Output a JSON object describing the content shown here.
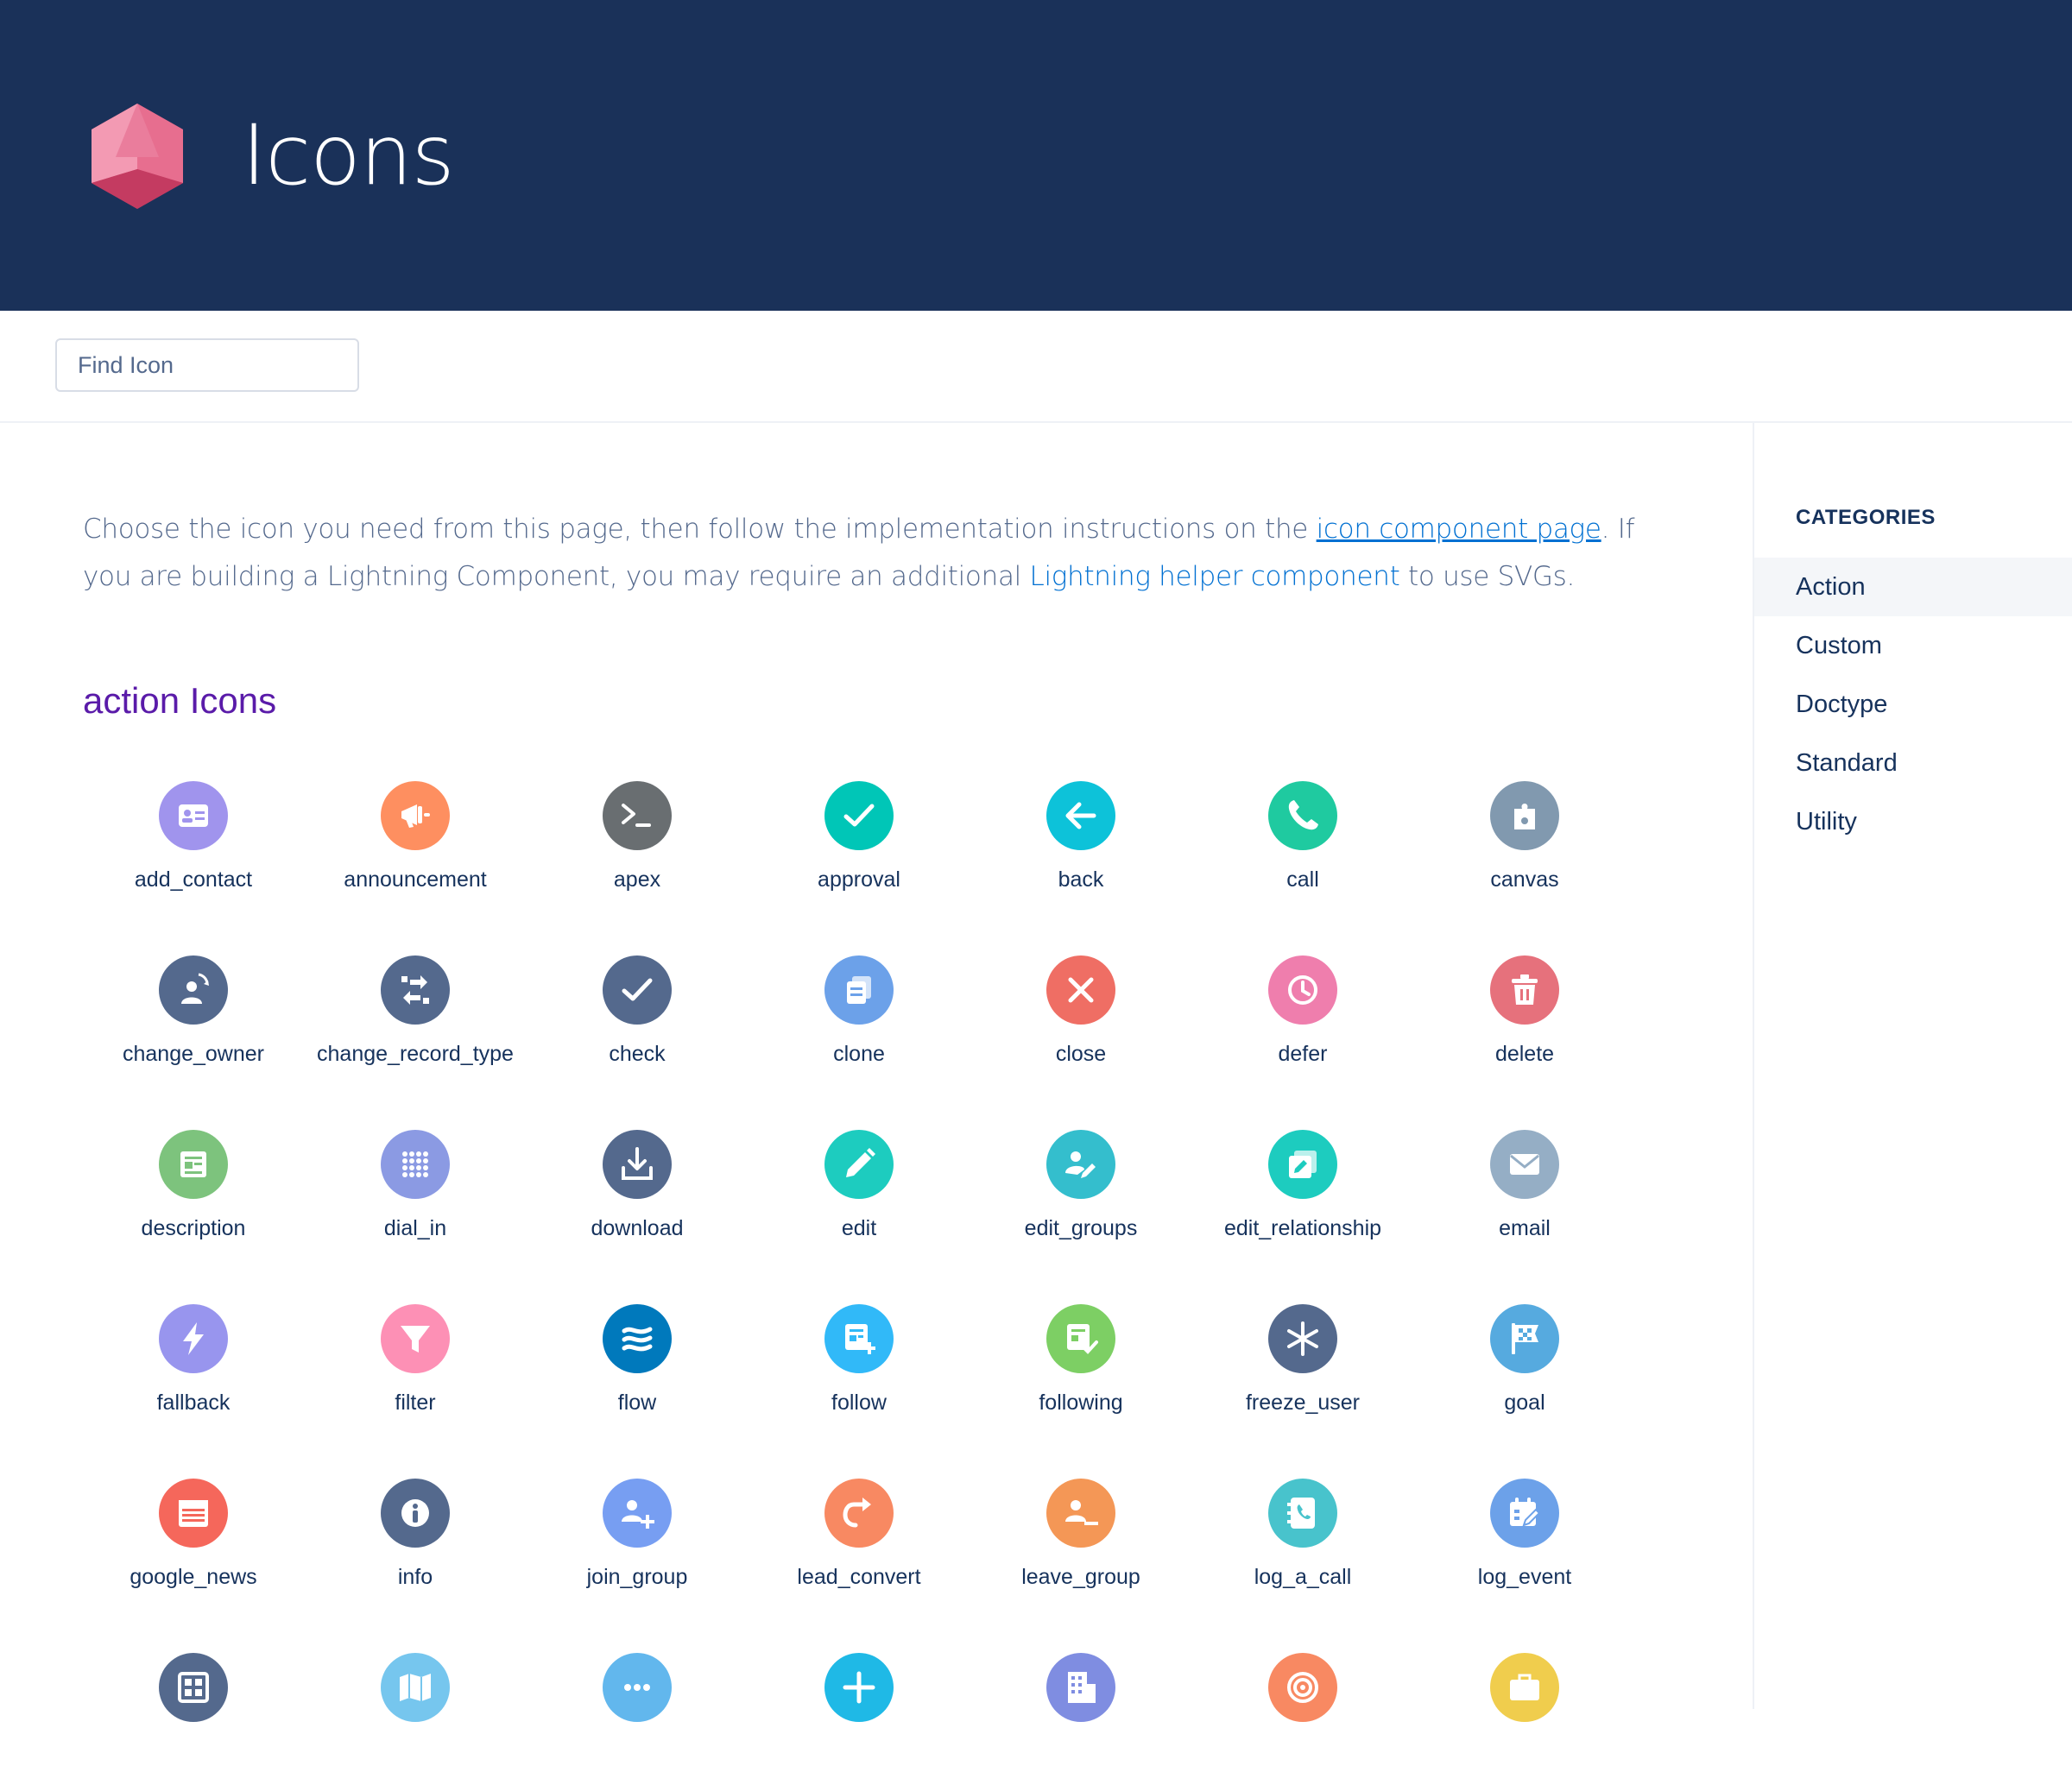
{
  "header": {
    "title": "Icons",
    "logo": "hexagon-gem-logo"
  },
  "search": {
    "placeholder": "Find Icon",
    "value": ""
  },
  "intro": {
    "part1": "Choose the icon you need from this page, then follow the implementation instructions on the ",
    "link1": "icon component page",
    "part2": ". If you are building a Lightning Component, you may require an additional ",
    "link2": "Lightning helper component",
    "part3": " to use SVGs."
  },
  "section": {
    "title": "action Icons"
  },
  "sidebar": {
    "heading": "CATEGORIES",
    "items": [
      {
        "label": "Action",
        "active": true
      },
      {
        "label": "Custom",
        "active": false
      },
      {
        "label": "Doctype",
        "active": false
      },
      {
        "label": "Standard",
        "active": false
      },
      {
        "label": "Utility",
        "active": false
      }
    ]
  },
  "icons": [
    {
      "name": "add_contact",
      "color": "#a094ed",
      "icon": "contact-card-icon"
    },
    {
      "name": "announcement",
      "color": "#fe8f60",
      "icon": "megaphone-icon"
    },
    {
      "name": "apex",
      "color": "#696e71",
      "icon": "terminal-icon"
    },
    {
      "name": "approval",
      "color": "#00c6b7",
      "icon": "check-icon"
    },
    {
      "name": "back",
      "color": "#0dc2d9",
      "icon": "arrow-left-icon"
    },
    {
      "name": "call",
      "color": "#1fcaa0",
      "icon": "phone-icon"
    },
    {
      "name": "canvas",
      "color": "#8199af",
      "icon": "puzzle-icon"
    },
    {
      "name": "change_owner",
      "color": "#54698d",
      "icon": "person-swap-icon"
    },
    {
      "name": "change_record_type",
      "color": "#54698d",
      "icon": "swap-arrows-icon"
    },
    {
      "name": "check",
      "color": "#54698d",
      "icon": "check-icon"
    },
    {
      "name": "clone",
      "color": "#6ca1e9",
      "icon": "copy-icon"
    },
    {
      "name": "close",
      "color": "#ef6e64",
      "icon": "x-icon"
    },
    {
      "name": "defer",
      "color": "#ef7ead",
      "icon": "clock-icon"
    },
    {
      "name": "delete",
      "color": "#e6717c",
      "icon": "trash-icon"
    },
    {
      "name": "description",
      "color": "#7dc37d",
      "icon": "document-icon"
    },
    {
      "name": "dial_in",
      "color": "#8b9ae3",
      "icon": "keypad-icon"
    },
    {
      "name": "download",
      "color": "#54698d",
      "icon": "download-icon"
    },
    {
      "name": "edit",
      "color": "#1dccbf",
      "icon": "pencil-icon"
    },
    {
      "name": "edit_groups",
      "color": "#34becd",
      "icon": "group-edit-icon"
    },
    {
      "name": "edit_relationship",
      "color": "#1dccbf",
      "icon": "relationship-edit-icon"
    },
    {
      "name": "email",
      "color": "#95aec5",
      "icon": "envelope-icon"
    },
    {
      "name": "fallback",
      "color": "#9895ee",
      "icon": "lightning-bolt-icon"
    },
    {
      "name": "filter",
      "color": "#fd90b5",
      "icon": "funnel-icon"
    },
    {
      "name": "flow",
      "color": "#0079bc",
      "icon": "waves-icon"
    },
    {
      "name": "follow",
      "color": "#31b9f8",
      "icon": "document-plus-icon"
    },
    {
      "name": "following",
      "color": "#7dcf64",
      "icon": "document-check-icon"
    },
    {
      "name": "freeze_user",
      "color": "#54698d",
      "icon": "snowflake-icon"
    },
    {
      "name": "goal",
      "color": "#56aadf",
      "icon": "flag-icon"
    },
    {
      "name": "google_news",
      "color": "#f5675b",
      "icon": "newspaper-icon"
    },
    {
      "name": "info",
      "color": "#54698d",
      "icon": "info-icon"
    },
    {
      "name": "join_group",
      "color": "#779ef2",
      "icon": "group-plus-icon"
    },
    {
      "name": "lead_convert",
      "color": "#f88962",
      "icon": "convert-arrow-icon"
    },
    {
      "name": "leave_group",
      "color": "#f49756",
      "icon": "group-minus-icon"
    },
    {
      "name": "log_a_call",
      "color": "#48c3cc",
      "icon": "phone-book-icon"
    },
    {
      "name": "log_event",
      "color": "#6ca1e9",
      "icon": "calendar-edit-icon"
    },
    {
      "name": "",
      "color": "#54698d",
      "icon": "layout-grid-icon"
    },
    {
      "name": "",
      "color": "#76c6ee",
      "icon": "map-icon"
    },
    {
      "name": "",
      "color": "#62b7ed",
      "icon": "more-icon"
    },
    {
      "name": "",
      "color": "#1fb9e6",
      "icon": "plus-icon"
    },
    {
      "name": "",
      "color": "#7f8de1",
      "icon": "building-icon"
    },
    {
      "name": "",
      "color": "#f88962",
      "icon": "target-icon"
    },
    {
      "name": "",
      "color": "#f0cd4d",
      "icon": "briefcase-icon"
    }
  ]
}
